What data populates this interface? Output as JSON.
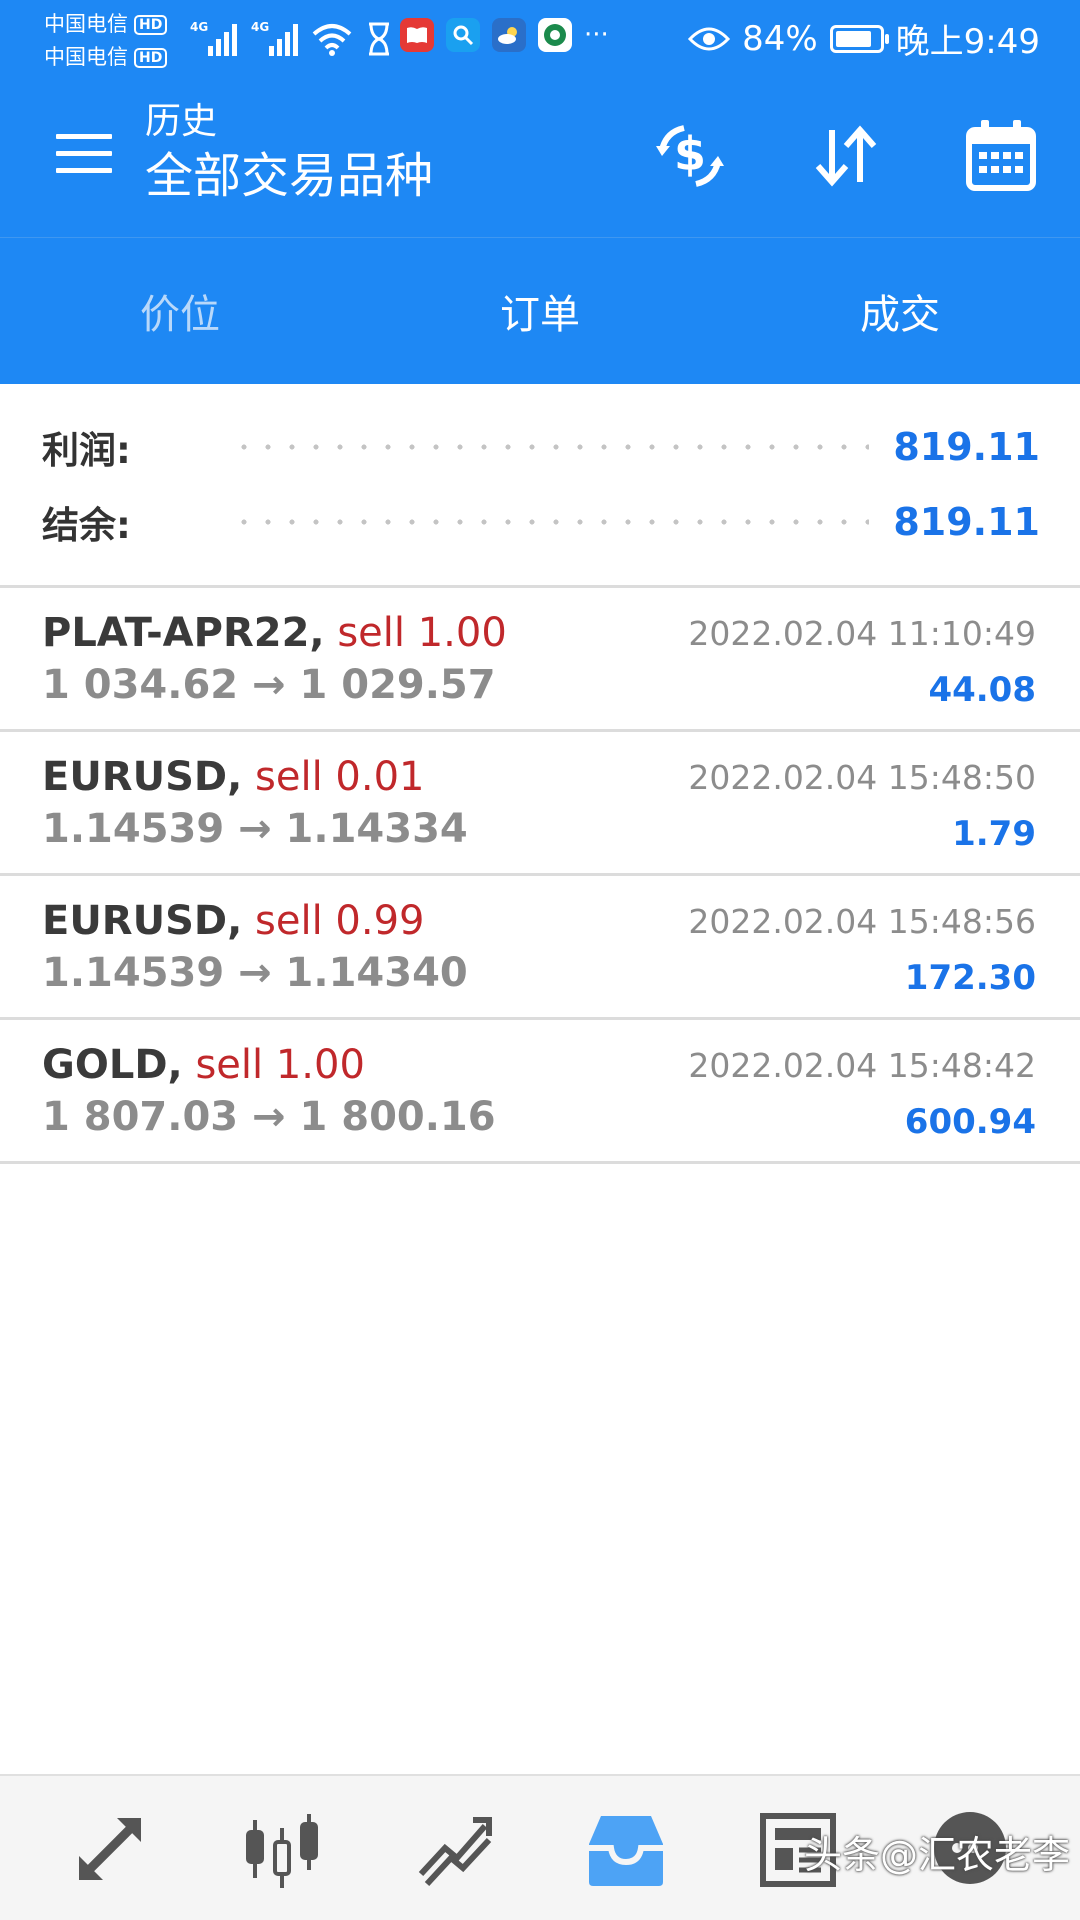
{
  "status_bar": {
    "carrier1": "中国电信",
    "carrier2": "中国电信",
    "hd": "HD",
    "net1": "4G",
    "net2": "4G",
    "battery_percent": "84%",
    "battery_level": 0.84,
    "time": "晚上9:49",
    "more": "···"
  },
  "header": {
    "subtitle": "历史",
    "title": "全部交易品种"
  },
  "tabs": [
    {
      "label": "价位",
      "active": false
    },
    {
      "label": "订单",
      "active": false
    },
    {
      "label": "成交",
      "active": true
    }
  ],
  "summary": {
    "profit_label": "利润:",
    "profit_value": "819.11",
    "balance_label": "结余:",
    "balance_value": "819.11"
  },
  "deals": [
    {
      "symbol": "PLAT-APR22,",
      "action": "sell 1.00",
      "prices": "1 034.62 → 1 029.57",
      "time": "2022.02.04 11:10:49",
      "profit": "44.08"
    },
    {
      "symbol": "EURUSD,",
      "action": "sell 0.01",
      "prices": "1.14539 → 1.14334",
      "time": "2022.02.04 15:48:50",
      "profit": "1.79"
    },
    {
      "symbol": "EURUSD,",
      "action": "sell 0.99",
      "prices": "1.14539 → 1.14340",
      "time": "2022.02.04 15:48:56",
      "profit": "172.30"
    },
    {
      "symbol": "GOLD,",
      "action": "sell 1.00",
      "prices": "1 807.03 → 1 800.16",
      "time": "2022.02.04 15:48:42",
      "profit": "600.94"
    }
  ],
  "watermark": "头条@汇农老李",
  "colors": {
    "brand_blue": "#1e88f4",
    "value_blue": "#1a73e8",
    "sell_red": "#c0282b",
    "active_nav": "#4da3f5"
  },
  "icons": {
    "menu": "menu-icon",
    "currency": "dollar-exchange-icon",
    "sort": "sort-arrows-icon",
    "calendar": "calendar-icon",
    "nav": [
      "quotes-arrows-icon",
      "chart-candles-icon",
      "trade-chart-icon",
      "history-inbox-icon",
      "news-icon",
      "messages-icon"
    ]
  }
}
